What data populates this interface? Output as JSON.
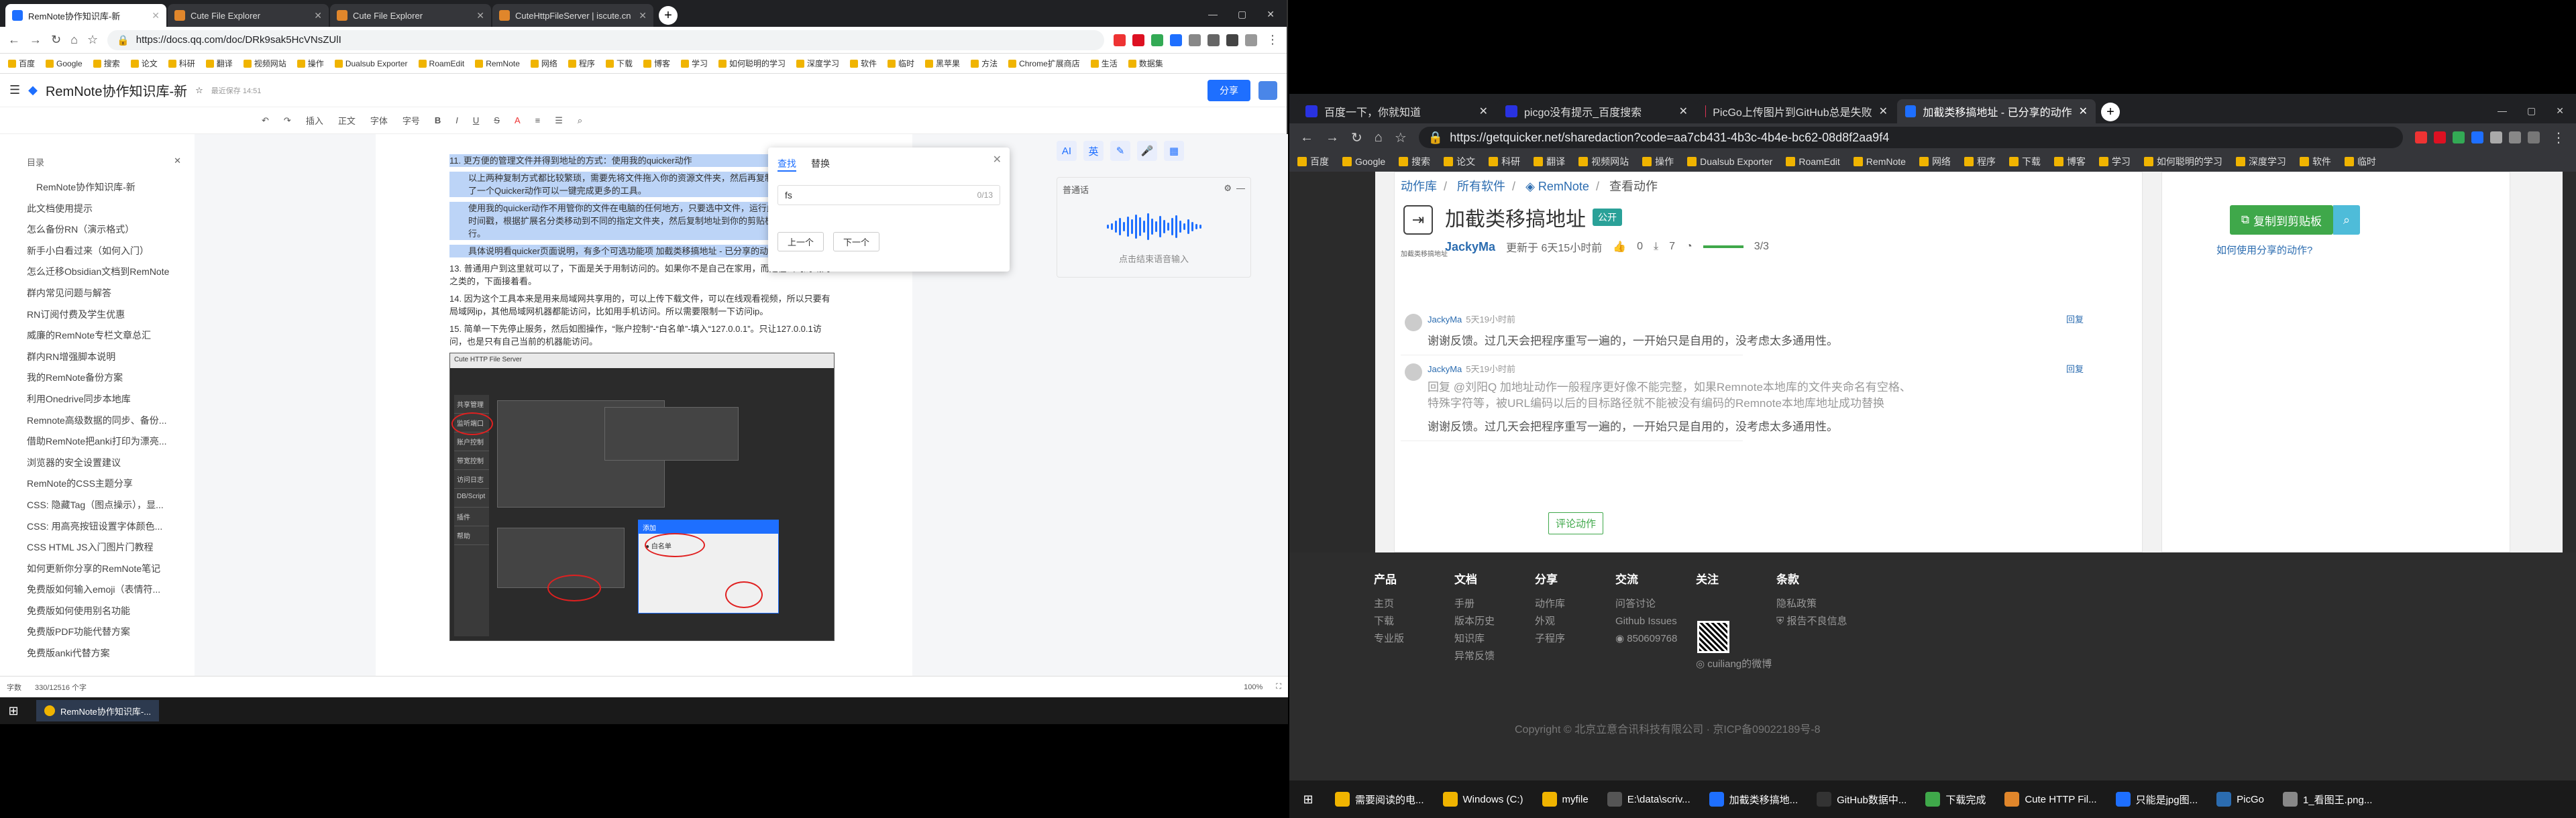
{
  "left_browser": {
    "tabs": [
      {
        "title": "RemNote协作知识库-新",
        "color": "#1e6fff"
      },
      {
        "title": "Cute File Explorer",
        "color": "#e0862b"
      },
      {
        "title": "Cute File Explorer",
        "color": "#e0862b"
      },
      {
        "title": "CuteHttpFileServer | iscute.cn",
        "color": "#e0862b"
      }
    ],
    "url": "https://docs.qq.com/doc/DRk9sak5HcVNsZUlI",
    "bookmarks": [
      "百度",
      "Google",
      "搜索",
      "论文",
      "科研",
      "翻译",
      "视频网站",
      "操作",
      "Dualsub Exporter",
      "RoamEdit",
      "RemNote",
      "网络",
      "程序",
      "下载",
      "博客",
      "学习",
      "如何聪明的学习",
      "深度学习",
      "软件",
      "临时",
      "黑苹果",
      "方法",
      "Chrome扩展商店",
      "生活",
      "数据集"
    ]
  },
  "doc": {
    "title": "RemNote协作知识库-新",
    "saved": "最近保存 14:51",
    "share": "分享",
    "toolbar": [
      "插入",
      "正文",
      "字体",
      "字号",
      "B",
      "I",
      "U",
      "S",
      "A"
    ],
    "outline_title": "目录",
    "outline": [
      {
        "text": "RemNote协作知识库-新",
        "sub": true
      },
      {
        "text": "此文档使用提示",
        "sub": false
      },
      {
        "text": "怎么备份RN（演示格式）",
        "sub": false
      },
      {
        "text": "新手小白看过来（如何入门）",
        "sub": false
      },
      {
        "text": "怎么迁移Obsidian文档到RemNote",
        "sub": false
      },
      {
        "text": "群内常见问题与解答",
        "sub": false
      },
      {
        "text": "RN订阅付费及学生优惠",
        "sub": false
      },
      {
        "text": "威廉的RemNote专栏文章总汇",
        "sub": false
      },
      {
        "text": "群内RN增强脚本说明",
        "sub": false
      },
      {
        "text": "我的RemNote备份方案",
        "sub": false
      },
      {
        "text": "利用Onedrive同步本地库",
        "sub": false
      },
      {
        "text": "Remnote高级数据的同步、备份...",
        "sub": false
      },
      {
        "text": "借助RemNote把anki打印为漂亮...",
        "sub": false
      },
      {
        "text": "浏览器的安全设置建议",
        "sub": false
      },
      {
        "text": "RemNote的CSS主题分享",
        "sub": false
      },
      {
        "text": "CSS: 隐藏Tag（图点操示），显...",
        "sub": false
      },
      {
        "text": "CSS: 用高亮按钮设置字体颜色...",
        "sub": false
      },
      {
        "text": "CSS HTML JS入门图片门教程",
        "sub": false
      },
      {
        "text": "如何更新你分享的RemNote笔记",
        "sub": false
      },
      {
        "text": "免费版如何输入emoji（表情符...",
        "sub": false
      },
      {
        "text": "免费版如何使用别名功能",
        "sub": false
      },
      {
        "text": "免费版PDF功能代替方案",
        "sub": false
      },
      {
        "text": "免费版anki代替方案",
        "sub": false
      }
    ],
    "body": [
      {
        "text": "11. 更方便的管理文件并得到地址的方式：使用我的quicker动作",
        "hl": true,
        "ind": false
      },
      {
        "text": "以上两种复制方式都比较繁琐，需要先将文件拖入你的资源文件夹，然后再复制路径。所以我写了一个Quicker动作可以一键完成更多的工具。",
        "hl": true,
        "ind": true
      },
      {
        "text": "使用我的quicker动作不用管你的文件在电脑的任何地方，只要选中文件，运行此动作，自动添加时间戳，根据扩展名分类移动到不同的指定文件夹，然后复制地址到你的剪贴板，你只管粘贴就行。",
        "hl": true,
        "ind": true
      },
      {
        "text": "具体说明看quicker页面说明，有多个可选功能项 加截类移搞地址 - 已分享的动作 - Quicker",
        "hl": true,
        "ind": true
      },
      {
        "text": "13. 普通用户到这里就可以了，下面是关于用制访问的。如果你不是自己在家用，而是在公司局域网之类的，下面接着看。",
        "hl": false,
        "ind": false
      },
      {
        "text": "14. 因为这个工具本来是用来局域网共享用的，可以上传下载文件，可以在线观看视频，所以只要有局域网ip，其他局域网机器都能访问，比如用手机访问。所以需要限制一下访问ip。",
        "hl": false,
        "ind": false
      },
      {
        "text": "15. 简单一下先停止服务，然后如图操作，“账户控制”-“白名单”-填入“127.0.0.1”。只让127.0.0.1访问，也是只有自己当前的机器能访问。",
        "hl": false,
        "ind": false
      }
    ],
    "screenshot": {
      "title": "Cute HTTP File Server",
      "side": [
        "共享管理",
        "监听端口",
        "账户控制",
        "带宽控制",
        "访问日志",
        "DB/Script",
        "插件",
        "帮助"
      ],
      "dialog_title": "添加",
      "dialog_opt": "● 白名单"
    },
    "find": {
      "tab_find": "查找",
      "tab_replace": "替换",
      "query": "fs",
      "count": "0/13",
      "prev": "上一个",
      "next": "下一个"
    },
    "voice": {
      "icons": [
        "AI",
        "英",
        "✎",
        "🎤",
        "▦"
      ],
      "mode": "普通话",
      "hint": "点击结束语音输入"
    },
    "status": {
      "count": "字数",
      "words": "330/12516 个字",
      "zoom": "100%"
    }
  },
  "left_taskbar": {
    "item": "RemNote协作知识库-..."
  },
  "right_browser": {
    "tabs": [
      {
        "title": "百度一下，你就知道",
        "color": "#2932e1"
      },
      {
        "title": "picgo没有提示_百度搜索",
        "color": "#2932e1"
      },
      {
        "title": "PicGo上传图片到GitHub总是失败",
        "color": "#d35"
      },
      {
        "title": "加截类移搞地址 - 已分享的动作",
        "color": "#1e6fff"
      }
    ],
    "url": "https://getquicker.net/sharedaction?code=aa7cb431-4b3c-4b4e-bc62-08d8f2aa9f4",
    "bookmarks": [
      "百度",
      "Google",
      "搜索",
      "论文",
      "科研",
      "翻译",
      "视频网站",
      "操作",
      "Dualsub Exporter",
      "RoamEdit",
      "RemNote",
      "网络",
      "程序",
      "下载",
      "博客",
      "学习",
      "如何聪明的学习",
      "深度学习",
      "软件",
      "临时"
    ]
  },
  "quicker": {
    "breadcrumb": [
      "动作库",
      "所有软件",
      "RemNote",
      "查看动作"
    ],
    "title": "加截类移搞地址",
    "badge": "公开",
    "icon_caption": "加截类移搞地址",
    "author": "JackyMa",
    "updated": "更新于 6天15小时前",
    "likes": "0",
    "downloads": "7",
    "progress": "3/3",
    "copy_btn": "复制到剪贴板",
    "howto": "如何使用分享的动作?",
    "comments": [
      {
        "name": "JackyMa",
        "time": "5天19小时前",
        "quote": "",
        "text": "谢谢反馈。过几天会把程序重写一遍的，一开始只是自用的，没考虑太多通用性。"
      },
      {
        "name": "JackyMa",
        "time": "5天19小时前",
        "quote": "回复 @刘阳Q 加地址动作一般程序更好像不能完整，如果Remnote本地库的文件夹命名有空格、特殊字符等，被URL编码以后的目标路径就不能被没有编码的Remnote本地库地址成功替换",
        "text": "谢谢反馈。过几天会把程序重写一遍的，一开始只是自用的，没考虑太多通用性。"
      }
    ],
    "reply": "回复",
    "more": "评论动作"
  },
  "footer": {
    "cols": [
      {
        "title": "产品",
        "items": [
          "主页",
          "下载",
          "专业版"
        ]
      },
      {
        "title": "文档",
        "items": [
          "手册",
          "版本历史",
          "知识库",
          "异常反馈"
        ]
      },
      {
        "title": "分享",
        "items": [
          "动作库",
          "外观",
          "子程序"
        ]
      },
      {
        "title": "交流",
        "items": [
          "问答讨论",
          "Github Issues",
          "850609768"
        ]
      },
      {
        "title": "关注",
        "items": [
          "cuiliang的微博"
        ]
      },
      {
        "title": "条款",
        "items": [
          "隐私政策",
          "报告不良信息"
        ]
      }
    ],
    "copyright": "Copyright © 北京立意合讯科技有限公司 · 京ICP备09022189号-8"
  },
  "right_taskbar": {
    "items": [
      "需要阅读的电...",
      "Windows (C:)",
      "myfile",
      "E:\\data\\scriv...",
      "加截类移搞地...",
      "GitHub数据中...",
      "下载完成",
      "Cute HTTP Fil...",
      "只能是jpg图...",
      "PicGo",
      "1_看图王.png..."
    ]
  }
}
